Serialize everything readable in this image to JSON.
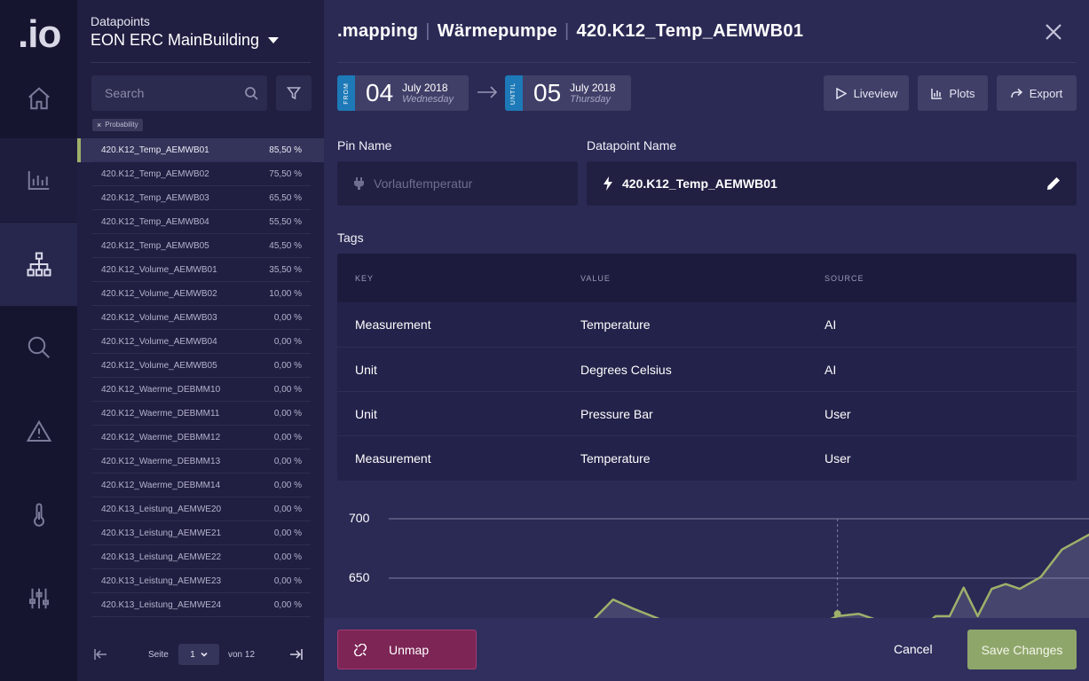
{
  "app": {
    "logo": ".io"
  },
  "rail": {
    "items": [
      {
        "icon": "home-icon"
      },
      {
        "icon": "bar-chart-icon"
      },
      {
        "icon": "hierarchy-icon",
        "active": true
      },
      {
        "icon": "search-icon"
      },
      {
        "icon": "warning-icon"
      },
      {
        "icon": "thermometer-icon"
      },
      {
        "icon": "sliders-icon"
      }
    ]
  },
  "list_panel": {
    "label": "Datapoints",
    "building": "EON ERC MainBuilding",
    "search_placeholder": "Search",
    "filter_chip": "Probability",
    "chip_remove": "×",
    "items": [
      {
        "name": "420.K12_Temp_AEMWB01",
        "value": "85,50 %",
        "selected": true
      },
      {
        "name": "420.K12_Temp_AEMWB02",
        "value": "75,50 %"
      },
      {
        "name": "420.K12_Temp_AEMWB03",
        "value": "65,50 %"
      },
      {
        "name": "420.K12_Temp_AEMWB04",
        "value": "55,50 %"
      },
      {
        "name": "420.K12_Temp_AEMWB05",
        "value": "45,50 %"
      },
      {
        "name": "420.K12_Volume_AEMWB01",
        "value": "35,50 %"
      },
      {
        "name": "420.K12_Volume_AEMWB02",
        "value": "10,00 %"
      },
      {
        "name": "420.K12_Volume_AEMWB03",
        "value": "0,00 %"
      },
      {
        "name": "420.K12_Volume_AEMWB04",
        "value": "0,00 %"
      },
      {
        "name": "420.K12_Volume_AEMWB05",
        "value": "0,00 %"
      },
      {
        "name": "420.K12_Waerme_DEBMM10",
        "value": "0,00 %"
      },
      {
        "name": "420.K12_Waerme_DEBMM11",
        "value": "0,00 %"
      },
      {
        "name": "420.K12_Waerme_DEBMM12",
        "value": "0,00 %"
      },
      {
        "name": "420.K12_Waerme_DEBMM13",
        "value": "0,00 %"
      },
      {
        "name": "420.K12_Waerme_DEBMM14",
        "value": "0,00 %"
      },
      {
        "name": "420.K13_Leistung_AEMWE20",
        "value": "0,00 %"
      },
      {
        "name": "420.K13_Leistung_AEMWE21",
        "value": "0,00 %"
      },
      {
        "name": "420.K13_Leistung_AEMWE22",
        "value": "0,00 %"
      },
      {
        "name": "420.K13_Leistung_AEMWE23",
        "value": "0,00 %"
      },
      {
        "name": "420.K13_Leistung_AEMWE24",
        "value": "0,00 %"
      }
    ],
    "pager": {
      "seite": "Seite",
      "page": "1",
      "von": "von 12"
    }
  },
  "main": {
    "title": {
      "part1": ".mapping",
      "part2": "Wärmepumpe",
      "part3": "420.K12_Temp_AEMWB01",
      "sep": "|"
    },
    "from": {
      "tag": "FROM",
      "day": "04",
      "month": "July 2018",
      "weekday": "Wednesday"
    },
    "until": {
      "tag": "UNTIL",
      "day": "05",
      "month": "July 2018",
      "weekday": "Thursday"
    },
    "buttons": {
      "liveview": "Liveview",
      "plots": "Plots",
      "export": "Export"
    },
    "pin_name_label": "Pin Name",
    "pin_name_value": "Vorlauftemperatur",
    "datapoint_name_label": "Datapoint Name",
    "datapoint_name_value": "420.K12_Temp_AEMWB01",
    "tags_label": "Tags",
    "tags": {
      "headers": {
        "key": "KEY",
        "value": "VALUE",
        "source": "SOURCE"
      },
      "rows": [
        {
          "key": "Measurement",
          "value": "Temperature",
          "source": "AI"
        },
        {
          "key": "Unit",
          "value": "Degrees Celsius",
          "source": "AI"
        },
        {
          "key": "Unit",
          "value": "Pressure Bar",
          "source": "User"
        },
        {
          "key": "Measurement",
          "value": "Temperature",
          "source": "User"
        }
      ]
    },
    "footer": {
      "unmap": "Unmap",
      "cancel": "Cancel",
      "save": "Save Changes"
    }
  },
  "chart_data": {
    "type": "area",
    "y_ticks": [
      "700",
      "650"
    ],
    "ylim": [
      590,
      714
    ],
    "x": [
      0.0,
      0.07,
      0.14,
      0.21,
      0.28,
      0.32,
      0.35,
      0.41,
      0.48,
      0.55,
      0.6,
      0.64,
      0.67,
      0.71,
      0.74,
      0.76,
      0.78,
      0.8,
      0.82,
      0.84,
      0.86,
      0.88,
      0.9,
      0.93,
      0.96,
      1.0
    ],
    "values": [
      610,
      605,
      612,
      600,
      608,
      632,
      624,
      610,
      606,
      612,
      608,
      618,
      620,
      612,
      606,
      608,
      618,
      618,
      642,
      618,
      641,
      645,
      641,
      651,
      674,
      687
    ],
    "marker": {
      "x": 0.64,
      "value": 620
    },
    "colors": {
      "line": "#9fb06a",
      "area": "#4a4a72",
      "grid": "#7f7ea3"
    }
  }
}
